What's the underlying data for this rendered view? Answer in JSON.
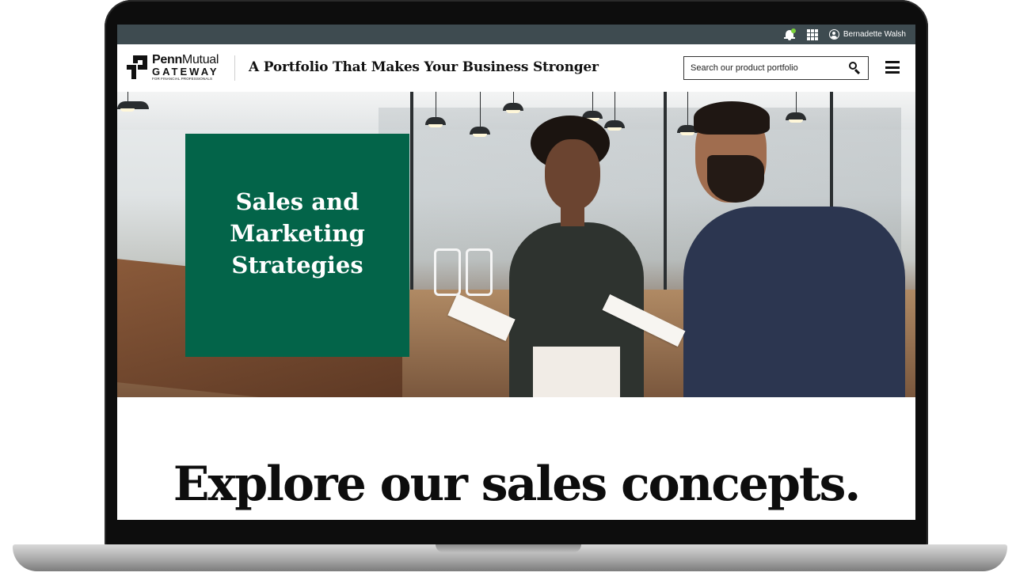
{
  "utility_bar": {
    "user_name": "Bernadette Walsh",
    "icons": [
      "bell-icon",
      "apps-grid-icon",
      "user-circle-icon"
    ],
    "notification_dot_color": "#7cd33b",
    "background": "#3e4b50"
  },
  "header": {
    "logo": {
      "penn_bold": "Penn",
      "penn_light": "Mutual",
      "gateway": "GATEWAY",
      "tagline": "FOR FINANCIAL PROFESSIONALS"
    },
    "title": "A Portfolio That Makes Your Business Stronger",
    "search": {
      "placeholder": "Search our product portfolio",
      "icon": "search-icon"
    },
    "menu_icon": "hamburger-menu-icon"
  },
  "hero": {
    "card_title": "Sales and Marketing Strategies",
    "card_color": "#036449"
  },
  "main": {
    "headline": "Explore our sales concepts."
  }
}
